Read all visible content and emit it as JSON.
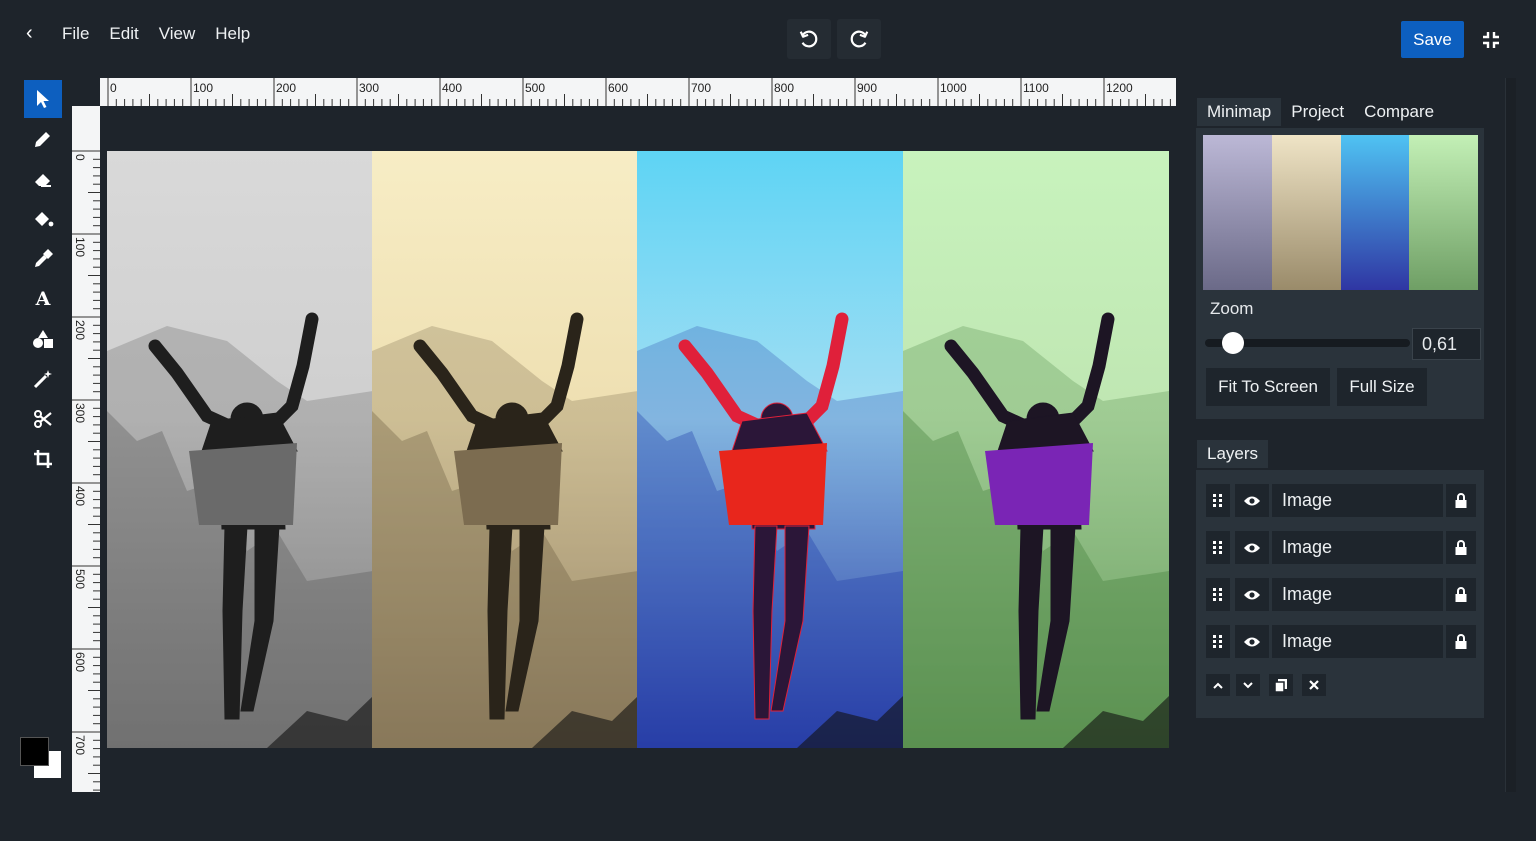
{
  "menu": {
    "items": [
      "File",
      "Edit",
      "View",
      "Help"
    ]
  },
  "toolbar_actions": {
    "save_label": "Save"
  },
  "tools": [
    "select-tool",
    "pencil-tool",
    "eraser-tool",
    "fill-tool",
    "eyedropper-tool",
    "text-tool",
    "shapes-tool",
    "magic-wand-tool",
    "cut-tool",
    "crop-tool"
  ],
  "colors": {
    "foreground": "#000000",
    "background": "#ffffff",
    "accent": "#0d5fbf"
  },
  "ruler": {
    "horizontal_labels": [
      "0",
      "100",
      "200",
      "300",
      "400",
      "500",
      "600",
      "700",
      "800",
      "900",
      "1000",
      "1100",
      "1200"
    ],
    "vertical_labels": [
      "0",
      "100",
      "200",
      "300",
      "400",
      "500",
      "600",
      "700"
    ]
  },
  "canvas": {
    "panels": [
      "grayscale",
      "sepia",
      "vivid-blue",
      "green"
    ]
  },
  "sidebar": {
    "tabs": [
      "Minimap",
      "Project",
      "Compare"
    ],
    "zoom_label": "Zoom",
    "zoom_value": "0,61",
    "zoom_level": 0.05,
    "fit_label": "Fit To Screen",
    "full_label": "Full Size"
  },
  "layers": {
    "tab_label": "Layers",
    "items": [
      {
        "name": "Image"
      },
      {
        "name": "Image"
      },
      {
        "name": "Image"
      },
      {
        "name": "Image"
      }
    ]
  }
}
